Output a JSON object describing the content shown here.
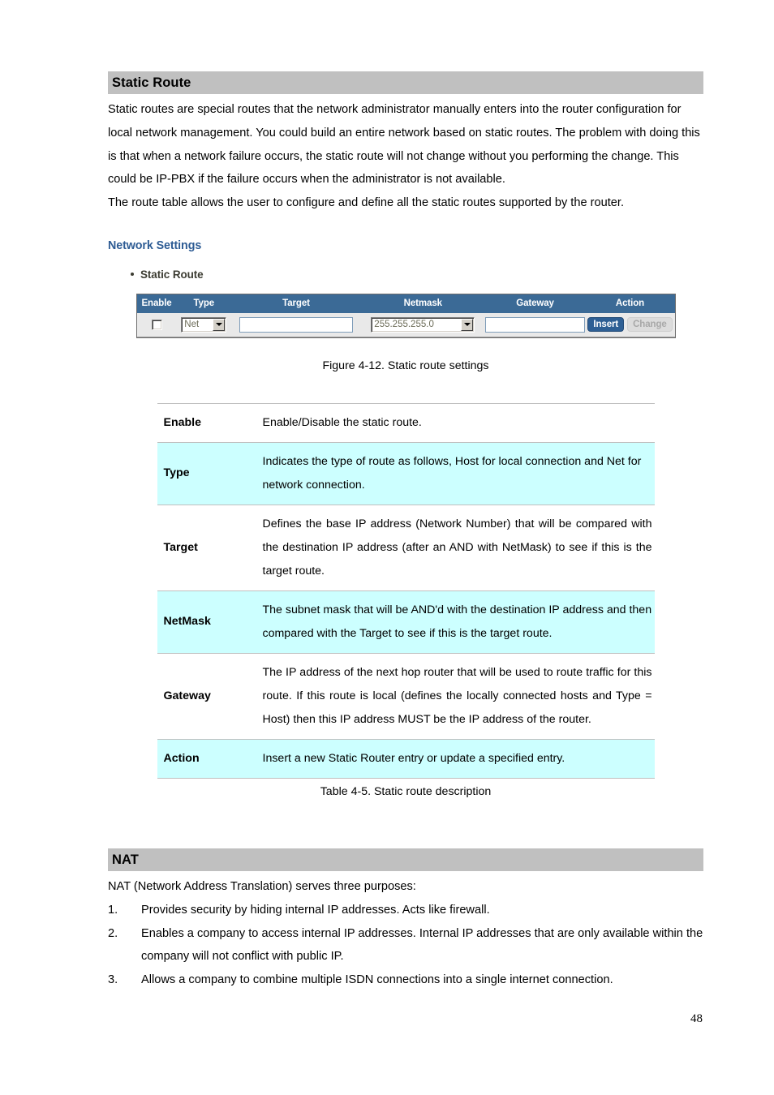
{
  "sections": {
    "static_route": {
      "heading": "Static Route",
      "paragraphs": [
        "Static routes are special routes that the network administrator manually enters into the router configuration for local network management. You could build an entire network based on static routes. The problem with doing this is that when a network failure occurs, the static route will not change without you performing the change. This could be IP-PBX if the failure occurs when the administrator is not available.",
        "The route table allows the user to configure and define all the static routes supported by the router."
      ],
      "subheading": "Network Settings",
      "bullet_label": "Static Route",
      "figure_caption": "Figure 4-12. Static route settings",
      "table_caption": "Table 4-5. Static route description"
    },
    "nat": {
      "heading": "NAT",
      "intro": "NAT (Network Address Translation) serves three purposes:",
      "items": [
        {
          "num": "1.",
          "text": "Provides security by hiding internal IP addresses. Acts like firewall."
        },
        {
          "num": "2.",
          "text": "Enables a company to access internal IP addresses. Internal IP addresses that are only available within the company will not conflict with public IP."
        },
        {
          "num": "3.",
          "text": "Allows a company to combine multiple ISDN connections into a single internet connection."
        }
      ]
    }
  },
  "router_widget": {
    "columns": [
      "Enable",
      "Type",
      "Target",
      "Netmask",
      "Gateway",
      "Action"
    ],
    "row": {
      "enable_checked": false,
      "type_value": "Net",
      "target_value": "",
      "target_placeholder": "",
      "netmask_value": "255.255.255.0",
      "gateway_value": "",
      "gateway_placeholder": "",
      "insert_label": "Insert",
      "change_label": "Change"
    },
    "colors": {
      "header_blue": "#3b6a96",
      "row_gray": "#e9e9e9",
      "insert_blue": "#2e5f94",
      "change_gray": "#dcdcdc"
    }
  },
  "description_table": {
    "rows": [
      {
        "term": "Enable",
        "definition": "Enable/Disable the static route.",
        "highlighted": false
      },
      {
        "term": "Type",
        "definition": "Indicates the type of route as follows, Host for local connection and Net for network connection.",
        "highlighted": true
      },
      {
        "term": "Target",
        "definition": "Defines the base IP address (Network Number) that will be compared with the destination IP address (after an AND with NetMask) to see if this is the target route.",
        "highlighted": false
      },
      {
        "term": "NetMask",
        "definition": "The subnet mask that will be AND'd with the destination IP address and then compared with the Target to see if this is the target route.",
        "highlighted": true
      },
      {
        "term": "Gateway",
        "definition": "The IP address of the next hop router that will be used to route traffic for this route. If this route is local (defines the locally connected hosts and Type = Host) then this IP address MUST be the IP address of the router.",
        "highlighted": false
      },
      {
        "term": "Action",
        "definition": "Insert a new Static Router entry or update a specified entry.",
        "highlighted": true
      }
    ],
    "highlight_color": "#ccffff"
  },
  "footer": {
    "page_number": "48"
  },
  "theme": {
    "section_bar_gray": "#c0c0c0",
    "subheading_blue": "#2e5c94"
  }
}
